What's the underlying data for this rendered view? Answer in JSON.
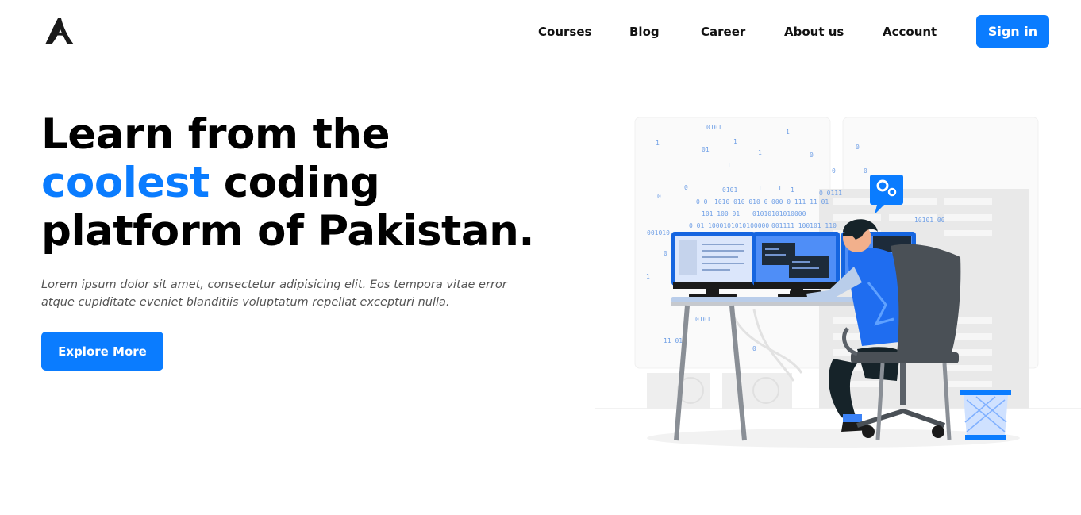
{
  "nav": {
    "logo_icon": "brand-a-logo",
    "links": [
      "Courses",
      "Blog",
      "Career",
      "About us",
      "Account"
    ],
    "signin_label": "Sign in"
  },
  "hero": {
    "title_before": "Learn from the ",
    "title_accent": "coolest",
    "title_after": " coding platform of Pakistan.",
    "description": "Lorem ipsum dolor sit amet, consectetur adipisicing elit. Eos tempora vitae error atque cupiditate eveniet blanditiis voluptatum repellat excepturi nulla.",
    "cta_label": "Explore More"
  },
  "colors": {
    "accent": "#0a7cff",
    "text": "#000000",
    "muted": "#555555"
  },
  "illustration": {
    "subject": "developer-at-desk-illustration",
    "binary_text": [
      "0101",
      "1",
      "01",
      "1",
      "1",
      "0",
      "1",
      "0",
      "0",
      "1",
      "0",
      "0101",
      "1",
      "1",
      "1",
      "0",
      "0 0",
      "1010 010 010 0",
      "000 0 111 11 01",
      "101 100 01",
      "01010101010000",
      "0 01 1000101010100000",
      "001111 100101 110",
      "001010",
      "0",
      "0",
      "0",
      "1",
      "0 0111",
      "10101 00",
      "0101",
      "11 01",
      "0"
    ]
  }
}
